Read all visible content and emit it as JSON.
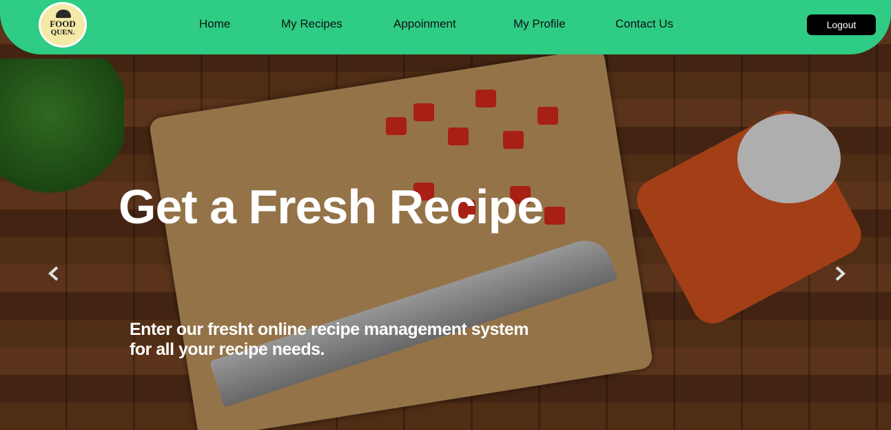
{
  "brand": {
    "logo_line1": "FOOD",
    "logo_line2": "QUEN."
  },
  "nav": {
    "items": [
      {
        "label": "Home"
      },
      {
        "label": "My Recipes"
      },
      {
        "label": "Appoinment"
      },
      {
        "label": "My Profile"
      },
      {
        "label": "Contact Us"
      }
    ],
    "logout_label": "Logout"
  },
  "hero": {
    "title": "Get a Fresh Recipe",
    "subtitle": "Enter our fresht online recipe management system for all your recipe needs."
  },
  "icons": {
    "prev": "chevron-left-icon",
    "next": "chevron-right-icon"
  },
  "colors": {
    "navbar": "#2ecc84",
    "logout_bg": "#000000",
    "hero_text": "#ffffff"
  }
}
